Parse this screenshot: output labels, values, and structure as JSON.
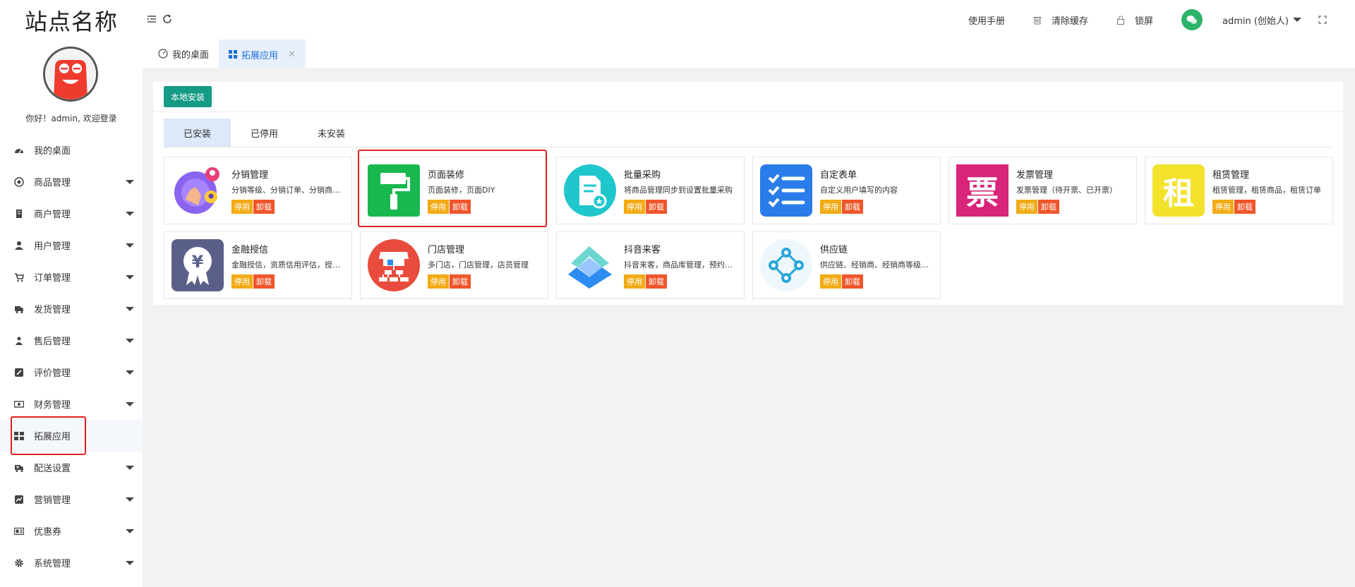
{
  "sidebar": {
    "site_name": "站点名称",
    "welcome": "你好！admin, 欢迎登录",
    "items": [
      {
        "label": "我的桌面",
        "icon": "dashboard-icon",
        "has_caret": false
      },
      {
        "label": "商品管理",
        "icon": "goods-icon",
        "has_caret": true
      },
      {
        "label": "商户管理",
        "icon": "building-icon",
        "has_caret": true
      },
      {
        "label": "用户管理",
        "icon": "user-icon",
        "has_caret": true
      },
      {
        "label": "订单管理",
        "icon": "cart-icon",
        "has_caret": true
      },
      {
        "label": "发货管理",
        "icon": "truck-icon",
        "has_caret": true
      },
      {
        "label": "售后管理",
        "icon": "service-icon",
        "has_caret": true
      },
      {
        "label": "评价管理",
        "icon": "edit-icon",
        "has_caret": true
      },
      {
        "label": "财务管理",
        "icon": "money-icon",
        "has_caret": true
      },
      {
        "label": "拓展应用",
        "icon": "grid-icon",
        "has_caret": false,
        "active": true
      },
      {
        "label": "配送设置",
        "icon": "delivery-icon",
        "has_caret": true
      },
      {
        "label": "营销管理",
        "icon": "marketing-icon",
        "has_caret": true
      },
      {
        "label": "优惠券",
        "icon": "coupon-icon",
        "has_caret": true
      },
      {
        "label": "系统管理",
        "icon": "gear-icon",
        "has_caret": true
      }
    ]
  },
  "topbar": {
    "manual": "使用手册",
    "clear_cache": "清除缓存",
    "lock": "锁屏",
    "user": "admin (创始人)"
  },
  "tabs": [
    {
      "label": "我的桌面",
      "icon": "gauge-icon"
    },
    {
      "label": "拓展应用",
      "icon": "grid-icon",
      "active": true
    }
  ],
  "main": {
    "local_install": "本地安装",
    "subtabs": [
      "已安装",
      "已停用",
      "未安装"
    ],
    "stop_label": "停用",
    "uninstall_label": "卸载",
    "apps": [
      {
        "title": "分销管理",
        "desc": "分销等级、分销订单、分销商管理",
        "icon": "distribution-icon",
        "color": "#8a63f0"
      },
      {
        "title": "页面装修",
        "desc": "页面装修，页面DIY",
        "icon": "paint-roller-icon",
        "color": "#19b84f"
      },
      {
        "title": "批量采购",
        "desc": "将商品管理同步到设置批量采购",
        "icon": "document-icon",
        "color": "#1fc7cc"
      },
      {
        "title": "自定表单",
        "desc": "自定义用户填写的内容",
        "icon": "checklist-icon",
        "color": "#2a7cea"
      },
      {
        "title": "发票管理",
        "desc": "发票管理（待开票、已开票）",
        "icon": "invoice-icon",
        "color": "#d8247a",
        "glyph": "票"
      },
      {
        "title": "租赁管理",
        "desc": "租赁管理，租赁商品，租赁订单",
        "icon": "rent-icon",
        "color": "#f2e22c",
        "glyph": "租"
      },
      {
        "title": "金融授信",
        "desc": "金融授信，资质信用评估，授信额度",
        "icon": "finance-icon",
        "color": "#5a5f8a",
        "glyph": "¥"
      },
      {
        "title": "门店管理",
        "desc": "多门店，门店管理，店员管理",
        "icon": "store-icon",
        "color": "#e94b3c"
      },
      {
        "title": "抖音来客",
        "desc": "抖音来客，商品库管理，预约管理",
        "icon": "douyin-icon",
        "color": "#2d8cf0"
      },
      {
        "title": "供应链",
        "desc": "供应链、经销商、经销商等级管理",
        "icon": "supply-chain-icon",
        "color": "#29a6d8"
      }
    ]
  }
}
